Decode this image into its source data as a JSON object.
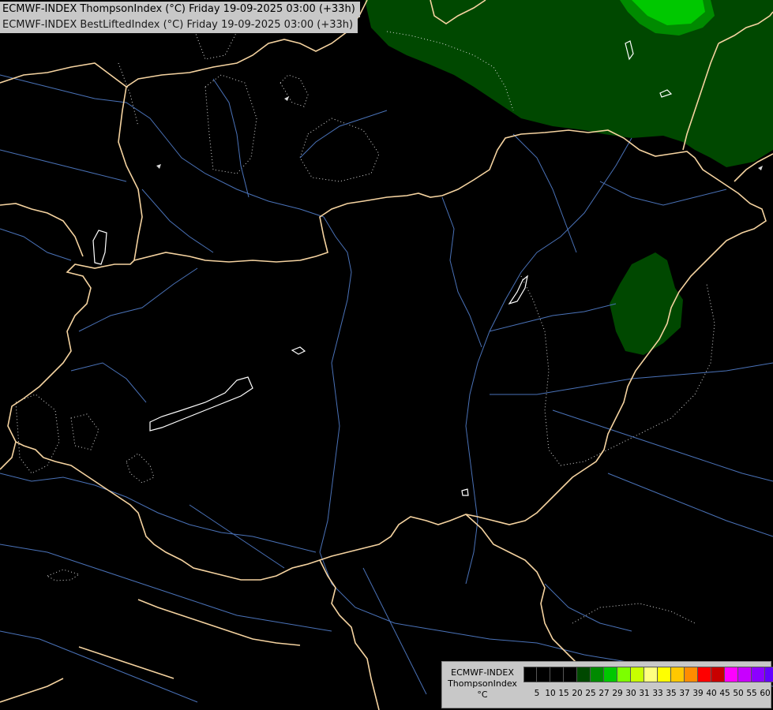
{
  "header": {
    "line1": "ECMWF-INDEX ThompsonIndex (°C) Friday 19-09-2025 03:00 (+33h)",
    "line2": "ECMWF-INDEX BestLiftedIndex (°C) Friday 19-09-2025 03:00 (+33h)"
  },
  "legend": {
    "title_line1": "ECMWF-INDEX",
    "title_line2": "ThompsonIndex",
    "title_line3": "°C",
    "ticks": [
      "5",
      "10",
      "15",
      "20",
      "25",
      "27",
      "29",
      "30",
      "31",
      "33",
      "35",
      "37",
      "39",
      "40",
      "45",
      "50",
      "55",
      "60"
    ],
    "colors": [
      "#000000",
      "#000000",
      "#000000",
      "#000000",
      "#004800",
      "#008a00",
      "#00c800",
      "#7cff00",
      "#c8ff00",
      "#ffff80",
      "#ffff00",
      "#ffc800",
      "#ff8c00",
      "#ff0000",
      "#c80000",
      "#ff00ff",
      "#c800ff",
      "#8c00ff",
      "#6400ff",
      "#0000ff"
    ]
  },
  "map": {
    "colors": {
      "background": "#000000",
      "border": "#f5d3a0",
      "river": "#4a72b8",
      "lake": "#ffffff",
      "contour": "#d8d8d8",
      "zone_dark": "#004800",
      "zone_mid": "#008a00",
      "zone_light": "#00c800"
    }
  }
}
